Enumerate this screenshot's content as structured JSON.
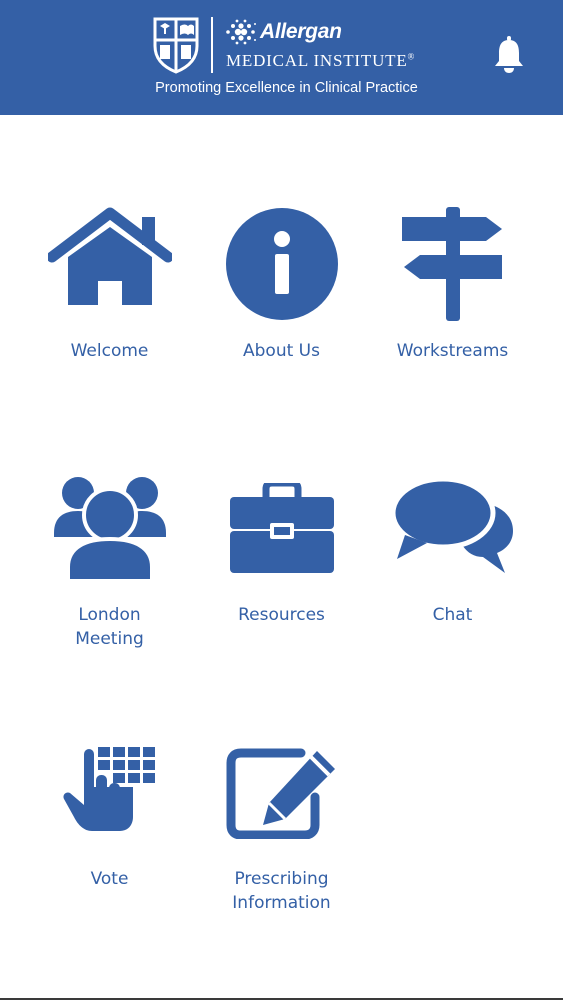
{
  "header": {
    "brand": "Allergan",
    "institute": "MEDICAL INSTITUTE",
    "registered_mark": "®",
    "tagline": "Promoting Excellence in Clinical Practice",
    "notification_icon": "bell-icon",
    "background_color": "#3460a6"
  },
  "menu": {
    "accent_color": "#3460a6",
    "items": [
      {
        "label": "Welcome",
        "icon": "home-icon"
      },
      {
        "label": "About Us",
        "icon": "info-icon"
      },
      {
        "label": "Workstreams",
        "icon": "signpost-icon"
      },
      {
        "label": "London\nMeeting",
        "icon": "group-icon"
      },
      {
        "label": "Resources",
        "icon": "briefcase-icon"
      },
      {
        "label": "Chat",
        "icon": "chat-bubbles-icon"
      },
      {
        "label": "Vote",
        "icon": "keypad-hand-icon"
      },
      {
        "label": "Prescribing\nInformation",
        "icon": "edit-document-icon"
      }
    ]
  }
}
